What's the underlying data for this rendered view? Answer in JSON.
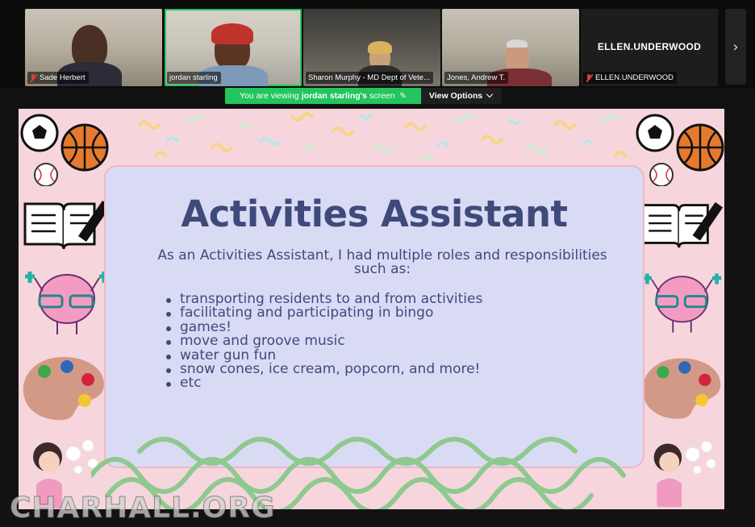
{
  "participants": [
    {
      "name": "Sade Herbert",
      "muted": true
    },
    {
      "name": "jordan starling",
      "muted": false,
      "active": true
    },
    {
      "name": "Sharon Murphy - MD Dept of Vete...",
      "muted": false
    },
    {
      "name": "Jones, Andrew T.",
      "muted": false
    },
    {
      "name": "ELLEN.UNDERWOOD",
      "display_name": "ELLEN.UNDERWOOD",
      "muted": true
    }
  ],
  "banner": {
    "prefix": "You are viewing",
    "presenter": "jordan starling's",
    "suffix": "screen",
    "options_label": "View Options"
  },
  "slide": {
    "title": "Activities Assistant",
    "intro": "As an Activities Assistant, I had multiple roles and responsibilities such as:",
    "items": [
      "transporting residents to and from activities",
      "facilitating and participating in bingo",
      "games!",
      "move and groove music",
      "water gun fun",
      "snow cones, ice cream, popcorn, and more!",
      "etc"
    ]
  },
  "watermark": "CHARHALL.ORG",
  "colors": {
    "active_green": "#23c55e",
    "slide_bg": "#f6d6dc",
    "card_bg": "#d9dbf5",
    "title_text": "#404a7a",
    "wave_green": "#8ec98f"
  }
}
